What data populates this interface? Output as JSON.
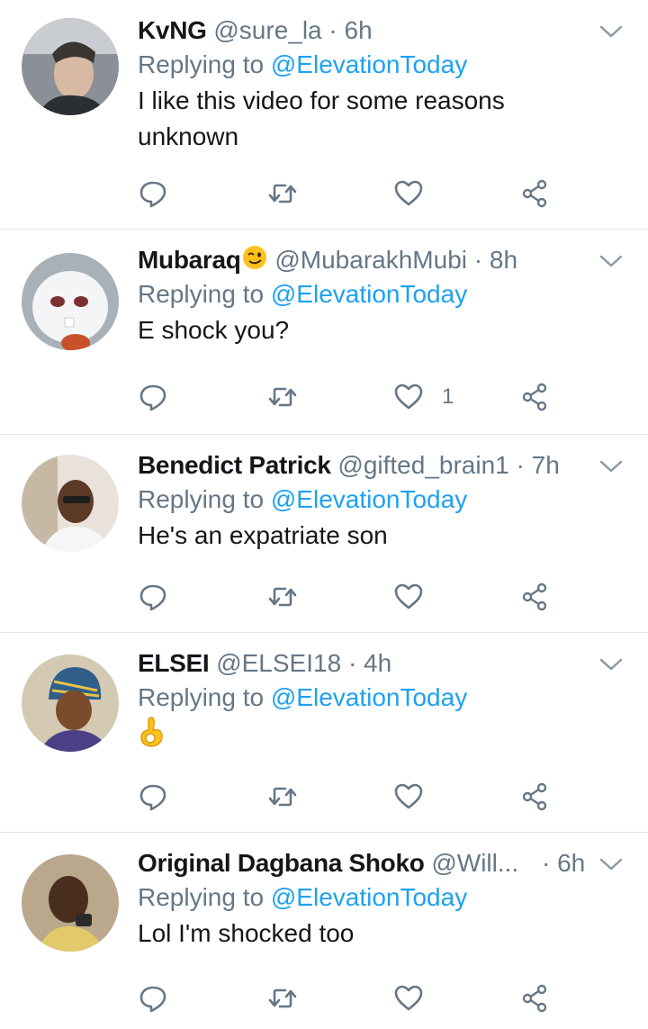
{
  "tweets": [
    {
      "name": "KvNG",
      "handle": "@sure_la",
      "time": "6h",
      "replying_label": "Replying to",
      "replying_to": "@ElevationToday",
      "text": "I like this video for some reasons unknown",
      "like_count": ""
    },
    {
      "name": "Mubaraq",
      "handle": "@MubarakhMubi",
      "time": "8h",
      "replying_label": "Replying to",
      "replying_to": "@ElevationToday",
      "text": "E shock you?",
      "like_count": "1"
    },
    {
      "name": "Benedict Patrick",
      "handle": "@gifted_brain1",
      "time": "7h",
      "replying_label": "Replying to",
      "replying_to": "@ElevationToday",
      "text": "He's an expatriate son",
      "like_count": ""
    },
    {
      "name": "ELSEI",
      "handle": "@ELSEI18",
      "time": "4h",
      "replying_label": "Replying to",
      "replying_to": "@ElevationToday",
      "text": "",
      "like_count": ""
    },
    {
      "name": "Original Dagbana Shoko",
      "handle": "@Will...",
      "time": "6h",
      "replying_label": "Replying to",
      "replying_to": "@ElevationToday",
      "text": "Lol I'm shocked too",
      "like_count": ""
    }
  ],
  "icons": {
    "reply": "reply-icon",
    "retweet": "retweet-icon",
    "like": "like-icon",
    "share": "share-icon",
    "caret": "chevron-down-icon"
  },
  "colors": {
    "mention": "#1da1f2",
    "secondary": "#657786",
    "divider": "#e1e8ed"
  }
}
